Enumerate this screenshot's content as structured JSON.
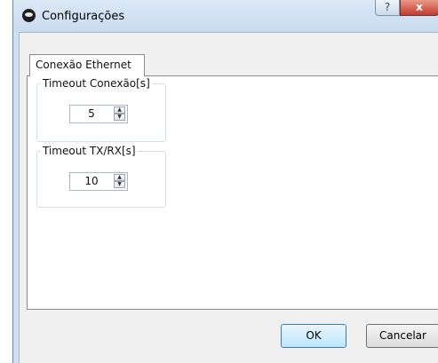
{
  "window": {
    "title": "Configurações",
    "help_glyph": "?",
    "close_glyph": "x"
  },
  "tabs": [
    {
      "label": "Conexão Ethernet"
    }
  ],
  "groups": [
    {
      "title": "Timeout Conexão[s]",
      "value": "5"
    },
    {
      "title": "Timeout TX/RX[s]",
      "value": "10"
    }
  ],
  "spin": {
    "up": "▲",
    "down": "▼"
  },
  "buttons": {
    "ok": "OK",
    "cancel": "Cancelar"
  },
  "icons": {
    "app": "app-logo-icon",
    "help": "help-icon",
    "close": "close-icon"
  },
  "colors": {
    "titlebar": "#cfe0f3",
    "close": "#c2392a",
    "ok_accent": "#3c7fb1"
  }
}
